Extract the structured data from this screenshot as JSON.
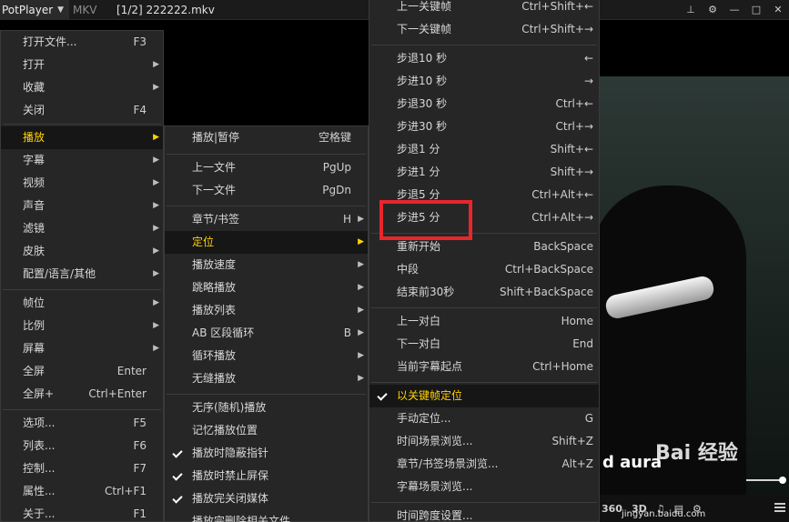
{
  "titlebar": {
    "app_name": "PotPlayer",
    "format": "MKV",
    "filename": "[1/2] 222222.mkv",
    "buttons": [
      "pin-icon",
      "settings-icon",
      "minimize-icon",
      "maximize-icon",
      "close-icon"
    ]
  },
  "menu1": [
    {
      "label": "打开文件...",
      "shortcut": "F3"
    },
    {
      "label": "打开",
      "submenu": true
    },
    {
      "label": "收藏",
      "submenu": true
    },
    {
      "label": "关闭",
      "shortcut": "F4"
    },
    {
      "label": "播放",
      "submenu": true,
      "highlighted": true
    },
    {
      "label": "字幕",
      "submenu": true
    },
    {
      "label": "视频",
      "submenu": true
    },
    {
      "label": "声音",
      "submenu": true
    },
    {
      "label": "滤镜",
      "submenu": true
    },
    {
      "label": "皮肤",
      "submenu": true
    },
    {
      "label": "配置/语言/其他",
      "submenu": true
    },
    {
      "label": "帧位",
      "submenu": true
    },
    {
      "label": "比例",
      "submenu": true
    },
    {
      "label": "屏幕",
      "submenu": true
    },
    {
      "label": "全屏",
      "shortcut": "Enter"
    },
    {
      "label": "全屏+",
      "shortcut": "Ctrl+Enter"
    },
    {
      "label": "选项...",
      "shortcut": "F5"
    },
    {
      "label": "列表...",
      "shortcut": "F6"
    },
    {
      "label": "控制...",
      "shortcut": "F7"
    },
    {
      "label": "属性...",
      "shortcut": "Ctrl+F1"
    },
    {
      "label": "关于...",
      "shortcut": "F1"
    }
  ],
  "menu2": [
    {
      "label": "播放|暂停",
      "shortcut": "空格键"
    },
    {
      "label": "上一文件",
      "shortcut": "PgUp"
    },
    {
      "label": "下一文件",
      "shortcut": "PgDn"
    },
    {
      "label": "章节/书签",
      "shortcut": "H",
      "submenu": true
    },
    {
      "label": "定位",
      "submenu": true,
      "highlighted": true
    },
    {
      "label": "播放速度",
      "submenu": true
    },
    {
      "label": "跳略播放",
      "submenu": true
    },
    {
      "label": "播放列表",
      "submenu": true
    },
    {
      "label": "AB 区段循环",
      "shortcut": "B",
      "submenu": true
    },
    {
      "label": "循环播放",
      "submenu": true
    },
    {
      "label": "无缝播放",
      "submenu": true
    },
    {
      "label": "无序(随机)播放"
    },
    {
      "label": "记忆播放位置"
    },
    {
      "label": "播放时隐蔽指针",
      "checked": true
    },
    {
      "label": "播放时禁止屏保",
      "checked": true
    },
    {
      "label": "播放完关闭媒体",
      "checked": true
    },
    {
      "label": "播放完删除相关文件"
    }
  ],
  "menu3": [
    {
      "label": "上一关键帧",
      "shortcut": "Ctrl+Shift+←"
    },
    {
      "label": "下一关键帧",
      "shortcut": "Ctrl+Shift+→"
    },
    {
      "label": "步退10 秒",
      "shortcut": "←"
    },
    {
      "label": "步进10 秒",
      "shortcut": "→"
    },
    {
      "label": "步退30 秒",
      "shortcut": "Ctrl+←"
    },
    {
      "label": "步进30 秒",
      "shortcut": "Ctrl+→"
    },
    {
      "label": "步退1 分",
      "shortcut": "Shift+←"
    },
    {
      "label": "步进1 分",
      "shortcut": "Shift+→"
    },
    {
      "label": "步退5 分",
      "shortcut": "Ctrl+Alt+←"
    },
    {
      "label": "步进5 分",
      "shortcut": "Ctrl+Alt+→"
    },
    {
      "label": "重新开始",
      "shortcut": "BackSpace"
    },
    {
      "label": "中段",
      "shortcut": "Ctrl+BackSpace"
    },
    {
      "label": "结束前30秒",
      "shortcut": "Shift+BackSpace"
    },
    {
      "label": "上一对白",
      "shortcut": "Home"
    },
    {
      "label": "下一对白",
      "shortcut": "End"
    },
    {
      "label": "当前字幕起点",
      "shortcut": "Ctrl+Home"
    },
    {
      "label": "以关键帧定位",
      "checked": true,
      "highlighted": true
    },
    {
      "label": "手动定位...",
      "shortcut": "G"
    },
    {
      "label": "时间场景浏览...",
      "shortcut": "Shift+Z"
    },
    {
      "label": "章节/书签场景浏览...",
      "shortcut": "Alt+Z"
    },
    {
      "label": "字幕场景浏览..."
    },
    {
      "label": "时间跨度设置..."
    }
  ],
  "video": {
    "overlay_text": "d aura",
    "watermark_text": "Bai 经验",
    "watermark_url": "jingyan.baidu.com"
  },
  "bottombar": {
    "btn_360": "360",
    "btn_3d": "3D",
    "icons": [
      "360-icon",
      "3d-icon",
      "audio-icon",
      "list-icon",
      "gear-icon",
      "menu-icon"
    ]
  },
  "colors": {
    "highlight_text": "#ffd200",
    "menu_bg": "#262626",
    "annotation_box": "#e8262c"
  }
}
